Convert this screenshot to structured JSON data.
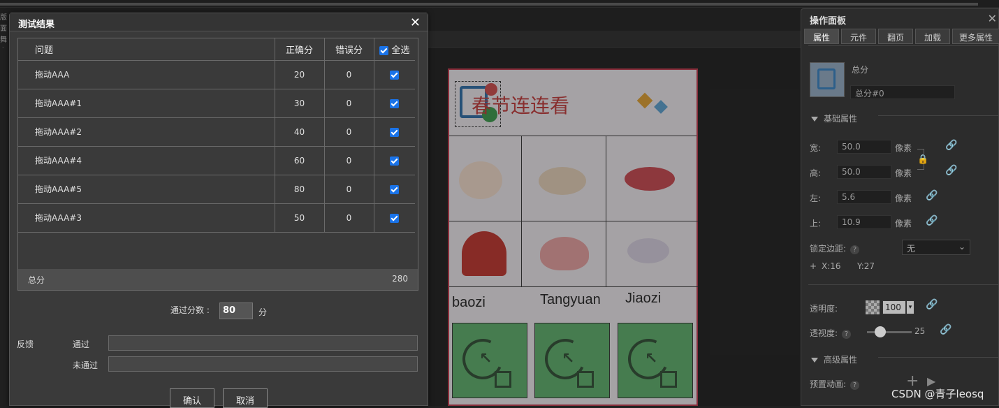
{
  "sidebar_stub": {
    "line1": "版面",
    "line2": "舞台"
  },
  "canvas": {
    "title": "春节连连看",
    "words": [
      "baozi",
      "Tangyuan",
      "Jiaozi"
    ]
  },
  "dialog": {
    "title": "测试结果",
    "columns": {
      "question": "问题",
      "correct": "正确分",
      "wrong": "错误分",
      "select_all": "全选"
    },
    "rows": [
      {
        "question": "拖动AAA",
        "correct": "20",
        "wrong": "0"
      },
      {
        "question": "拖动AAA#1",
        "correct": "30",
        "wrong": "0"
      },
      {
        "question": "拖动AAA#2",
        "correct": "40",
        "wrong": "0"
      },
      {
        "question": "拖动AAA#4",
        "correct": "60",
        "wrong": "0"
      },
      {
        "question": "拖动AAA#5",
        "correct": "80",
        "wrong": "0"
      },
      {
        "question": "拖动AAA#3",
        "correct": "50",
        "wrong": "0"
      }
    ],
    "total_label": "总分",
    "total_value": "280",
    "pass_label": "通过分数 :",
    "pass_value": "80",
    "pass_unit": "分",
    "feedback_label": "反馈",
    "pass_feedback_label": "通过",
    "fail_feedback_label": "未通过",
    "confirm": "确认",
    "cancel": "取消"
  },
  "panel": {
    "title": "操作面板",
    "tabs": [
      "属性",
      "元件",
      "翻页",
      "加载",
      "更多属性"
    ],
    "component_type": "总分",
    "component_name": "总分#0",
    "basic_section": "基础属性",
    "width_label": "宽:",
    "width_value": "50.0",
    "height_label": "高:",
    "height_value": "50.0",
    "left_label": "左:",
    "left_value": "5.6",
    "top_label": "上:",
    "top_value": "10.9",
    "unit": "像素",
    "lock_margin_label": "锁定边距:",
    "lock_margin_value": "无",
    "coord_x": "X:16",
    "coord_y": "Y:27",
    "opacity_label": "透明度:",
    "opacity_value": "100",
    "perspective_label": "透视度:",
    "perspective_value": "25",
    "advanced_section": "高级属性",
    "preset_anim_label": "预置动画:"
  },
  "watermark": "CSDN @青子leosq"
}
